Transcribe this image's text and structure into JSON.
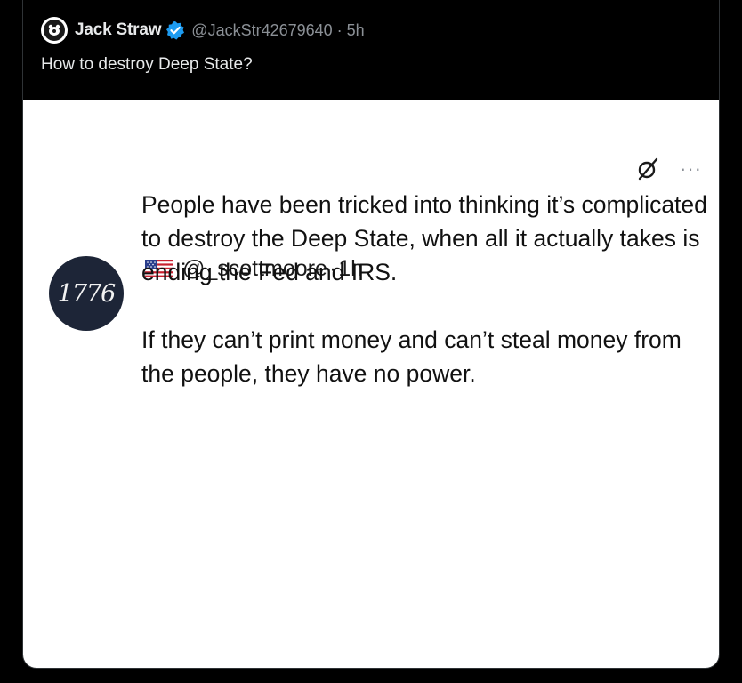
{
  "tweet": {
    "display_name": "Jack Straw",
    "handle": "@JackStr42679640",
    "separator": "·",
    "time": "5h",
    "text": "How to destroy Deep State?",
    "verified_icon": "verified-badge-icon",
    "verified_color": "#1d9bf0"
  },
  "embedded_post": {
    "avatar_text": "1776",
    "flag_icon": "us-flag-icon",
    "handle": "@_scottmoore",
    "separator": "·",
    "time": "1h",
    "grok_icon": "grok-icon",
    "more_icon": "more-options-icon",
    "more_label": "···",
    "paragraphs": [
      "People have been tricked into thinking it’s complicated to destroy the Deep State, when all it actually takes is ending the Fed and IRS.",
      "If they can’t print money and can’t steal money from the people, they have no power."
    ]
  },
  "colors": {
    "background": "#000000",
    "text_primary": "#e7e9ea",
    "text_secondary": "#8b9096",
    "media_background": "#ffffff",
    "avatar_navy": "#1d2537"
  }
}
